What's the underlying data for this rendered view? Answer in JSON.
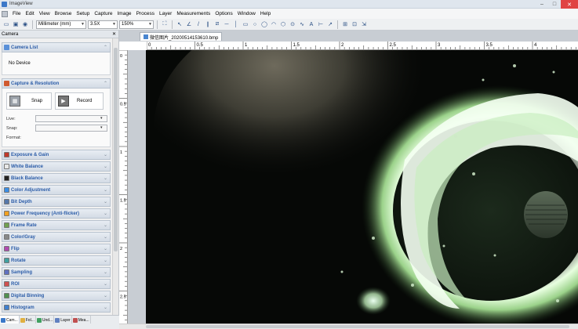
{
  "window": {
    "title": "ImageView"
  },
  "menu": [
    "File",
    "Edit",
    "View",
    "Browse",
    "Setup",
    "Capture",
    "Image",
    "Process",
    "Layer",
    "Measurements",
    "Options",
    "Window",
    "Help"
  ],
  "toolbar": {
    "unit": "Millimeter (mm)",
    "magnification": "3.5X",
    "zoom": "150%"
  },
  "panel": {
    "title": "Camera",
    "camera_list": {
      "label": "Camera List",
      "value": "No Device"
    },
    "capture": {
      "label": "Capture & Resolution",
      "snap_label": "Snap",
      "record_label": "Record",
      "live_label": "Live:",
      "snap_res_label": "Snap:",
      "format_label": "Format:"
    },
    "sections": [
      {
        "label": "Exposure & Gain",
        "color": "#c0392b"
      },
      {
        "label": "White Balance",
        "color": "#e8e8e8"
      },
      {
        "label": "Black Balance",
        "color": "#222222"
      },
      {
        "label": "Color Adjustment",
        "color": "#3a8ee6"
      },
      {
        "label": "Bit Depth",
        "color": "#5577aa"
      },
      {
        "label": "Power Frequency (Anti-flicker)",
        "color": "#f0a020"
      },
      {
        "label": "Frame Rate",
        "color": "#70a050"
      },
      {
        "label": "Color/Gray",
        "color": "#888888"
      },
      {
        "label": "Flip",
        "color": "#b04ab0"
      },
      {
        "label": "Rotate",
        "color": "#40a0a0"
      },
      {
        "label": "Sampling",
        "color": "#6070c0"
      },
      {
        "label": "ROI",
        "color": "#d05050"
      },
      {
        "label": "Digital Binning",
        "color": "#509050"
      },
      {
        "label": "Histogram",
        "color": "#4080d0"
      }
    ],
    "tabs": [
      "Cam...",
      "Fol...",
      "Und...",
      "Layer",
      "Mea..."
    ]
  },
  "document": {
    "tab_title": "微信图片_20200514153610.bmp",
    "ruler_h_labels": [
      "0",
      "0.5",
      "1",
      "1.5",
      "2",
      "2.5",
      "3",
      "3.5",
      "4"
    ],
    "ruler_v_labels": [
      "0",
      "0.5",
      "1",
      "1.5",
      "2",
      "2.5"
    ]
  }
}
